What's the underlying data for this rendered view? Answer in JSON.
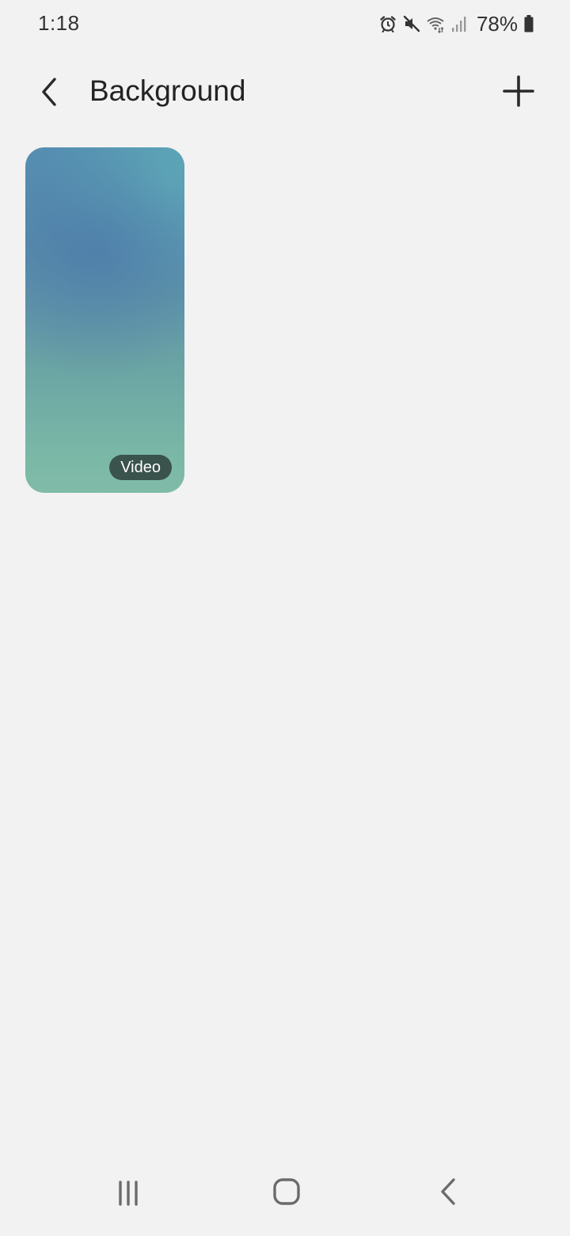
{
  "status_bar": {
    "time": "1:18",
    "battery_percent": "78%",
    "icons": [
      "alarm-icon",
      "mute-icon",
      "wifi-icon",
      "signal-icon",
      "battery-icon"
    ]
  },
  "app_bar": {
    "title": "Background",
    "back_icon": "chevron-left-icon",
    "add_icon": "plus-icon"
  },
  "backgrounds": [
    {
      "badge": "Video",
      "colors": [
        "#5690b2",
        "#6aa3a4",
        "#80bba8"
      ]
    }
  ],
  "nav_bar": {
    "icons": [
      "recents-icon",
      "home-icon",
      "back-icon"
    ]
  },
  "colors": {
    "page_bg": "#f2f2f2",
    "badge_bg": "#344a44",
    "text": "#232323"
  }
}
